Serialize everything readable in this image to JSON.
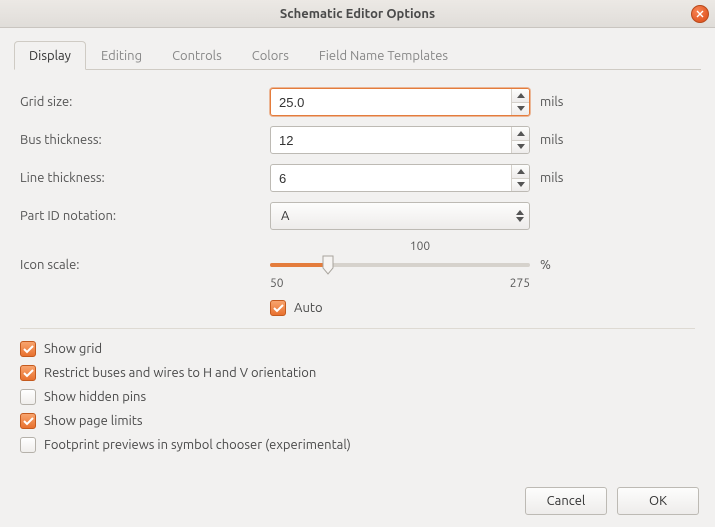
{
  "window": {
    "title": "Schematic Editor Options"
  },
  "tabs": [
    "Display",
    "Editing",
    "Controls",
    "Colors",
    "Field Name Templates"
  ],
  "active_tab": 0,
  "fields": {
    "grid_size": {
      "label": "Grid size:",
      "value": "25.0",
      "unit": "mils"
    },
    "bus_thickness": {
      "label": "Bus thickness:",
      "value": "12",
      "unit": "mils"
    },
    "line_thickness": {
      "label": "Line thickness:",
      "value": "6",
      "unit": "mils"
    },
    "part_id": {
      "label": "Part ID notation:",
      "value": "A"
    },
    "icon_scale": {
      "label": "Icon scale:",
      "value": 100,
      "min": 50,
      "max": 275,
      "unit": "%",
      "value_label": "100",
      "min_label": "50",
      "max_label": "275"
    },
    "auto": {
      "label": "Auto",
      "checked": true
    }
  },
  "checks": {
    "show_grid": {
      "label": "Show grid",
      "checked": true
    },
    "restrict": {
      "label": "Restrict buses and wires to H and V orientation",
      "checked": true
    },
    "hidden_pins": {
      "label": "Show hidden pins",
      "checked": false
    },
    "page_limits": {
      "label": "Show page limits",
      "checked": true
    },
    "footprint_prev": {
      "label": "Footprint previews in symbol chooser (experimental)",
      "checked": false
    }
  },
  "buttons": {
    "cancel": "Cancel",
    "ok": "OK"
  }
}
